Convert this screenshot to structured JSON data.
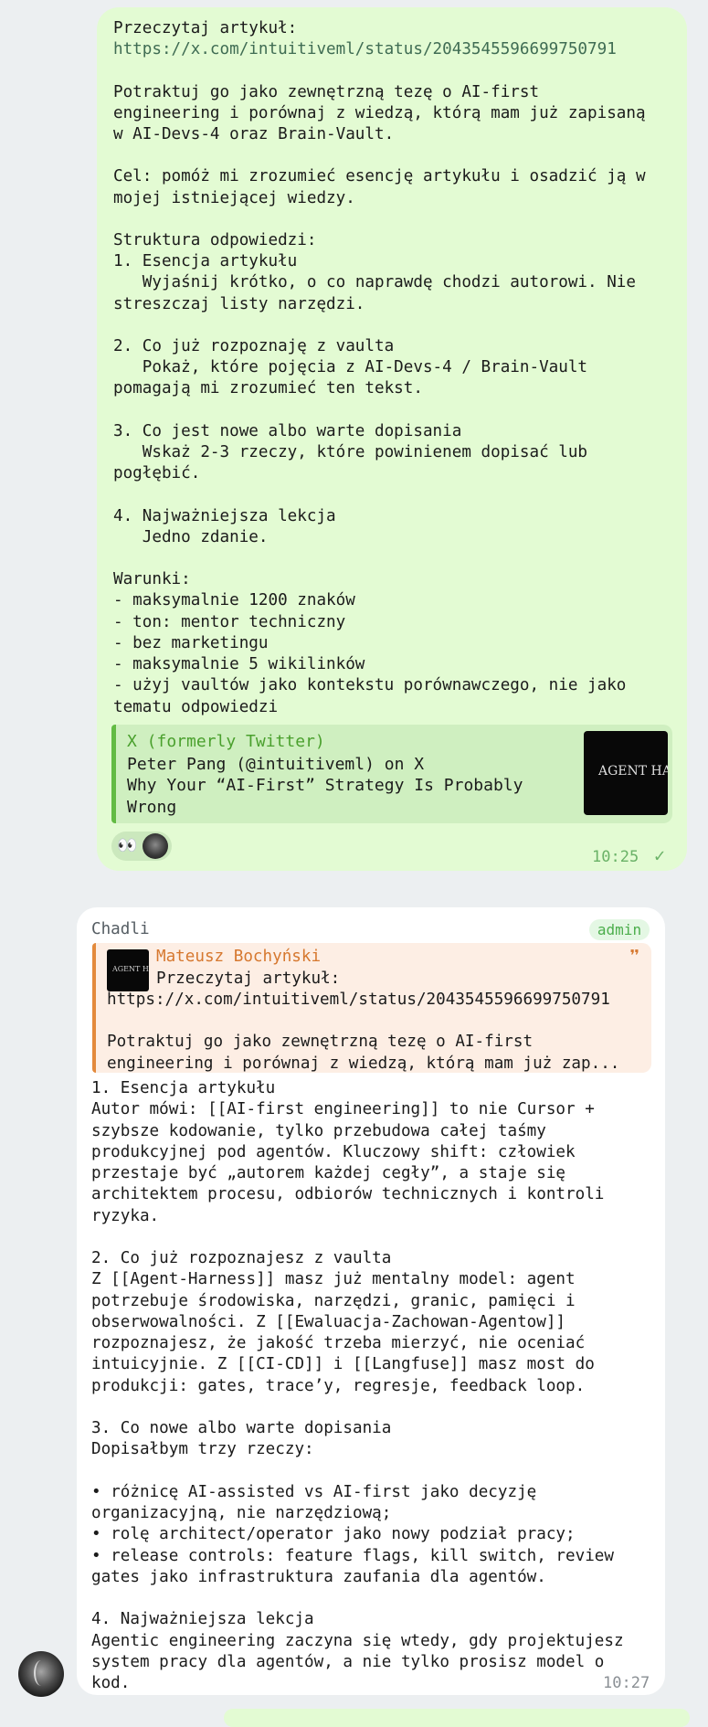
{
  "outgoing": {
    "text": "Przeczytaj artykuł:",
    "link": "https://x.com/intuitiveml/status/2043545596699750791",
    "body": "\nPotraktuj go jako zewnętrzną tezę o AI-first\nengineering i porównaj z wiedzą, którą mam już zapisaną\nw AI-Devs-4 oraz Brain-Vault.\n\nCel: pomóż mi zrozumieć esencję artykułu i osadzić ją w\nmojej istniejącej wiedzy.\n\nStruktura odpowiedzi:\n1. Esencja artykułu\n   Wyjaśnij krótko, o co naprawdę chodzi autorowi. Nie\nstreszczaj listy narzędzi.\n\n2. Co już rozpoznaję z vaulta\n   Pokaż, które pojęcia z AI-Devs-4 / Brain-Vault\npomagają mi zrozumieć ten tekst.\n\n3. Co jest nowe albo warte dopisania\n   Wskaż 2-3 rzeczy, które powinienem dopisać lub\npogłębić.\n\n4. Najważniejsza lekcja\n   Jedno zdanie.\n\nWarunki:\n- maksymalnie 1200 znaków\n- ton: mentor techniczny\n- bez marketingu\n- maksymalnie 5 wikilinków\n- użyj vaultów jako kontekstu porównawczego, nie jako\ntematu odpowiedzi",
    "preview": {
      "site": "X (formerly Twitter)",
      "title": "Peter Pang (@intuitiveml) on X\nWhy Your “AI-First” Strategy Is Probably\nWrong",
      "thumb_text": "AGENT HA"
    },
    "reactions": {
      "emoji": "👀"
    },
    "time": "10:25",
    "status_icon": "check-icon"
  },
  "incoming": {
    "sender": "Chadli",
    "badge": "admin",
    "reply": {
      "author": "Mateusz Bochyński",
      "thumb_text": "AGENT HA",
      "line1": "Przeczytaj artykuł:",
      "line2": "https://x.com/intuitiveml/status/2043545596699750791\n\nPotraktuj go jako zewnętrzną tezę o AI-first\nengineering i porównaj z wiedzą, którą mam już zap..."
    },
    "body": "1. Esencja artykułu\nAutor mówi: [[AI-first engineering]] to nie Cursor +\nszybsze kodowanie, tylko przebudowa całej taśmy\nprodukcyjnej pod agentów. Kluczowy shift: człowiek\nprzestaje być „autorem każdej cegły”, a staje się\narchitektem procesu, odbiorów technicznych i kontroli\nryzyka.\n\n2. Co już rozpoznajesz z vaulta\nZ [[Agent-Harness]] masz już mentalny model: agent\npotrzebuje środowiska, narzędzi, granic, pamięci i\nobserwowalności. Z [[Ewaluacja-Zachowan-Agentow]]\nrozpoznajesz, że jakość trzeba mierzyć, nie oceniać\nintuicyjnie. Z [[CI-CD]] i [[Langfuse]] masz most do\nprodukcji: gates, trace’y, regresje, feedback loop.\n\n3. Co nowe albo warte dopisania\nDopisałbym trzy rzeczy:\n\n• różnicę AI-assisted vs AI-first jako decyzję\norganizacyjną, nie narzędziową;\n• rolę architect/operator jako nowy podział pracy;\n• release controls: feature flags, kill switch, review\ngates jako infrastruktura zaufania dla agentów.\n\n4. Najważniejsza lekcja\nAgentic engineering zaczyna się wtedy, gdy projektujesz\nsystem pracy dla agentów, a nie tylko prosisz model o\nkod.",
    "time": "10:27"
  }
}
